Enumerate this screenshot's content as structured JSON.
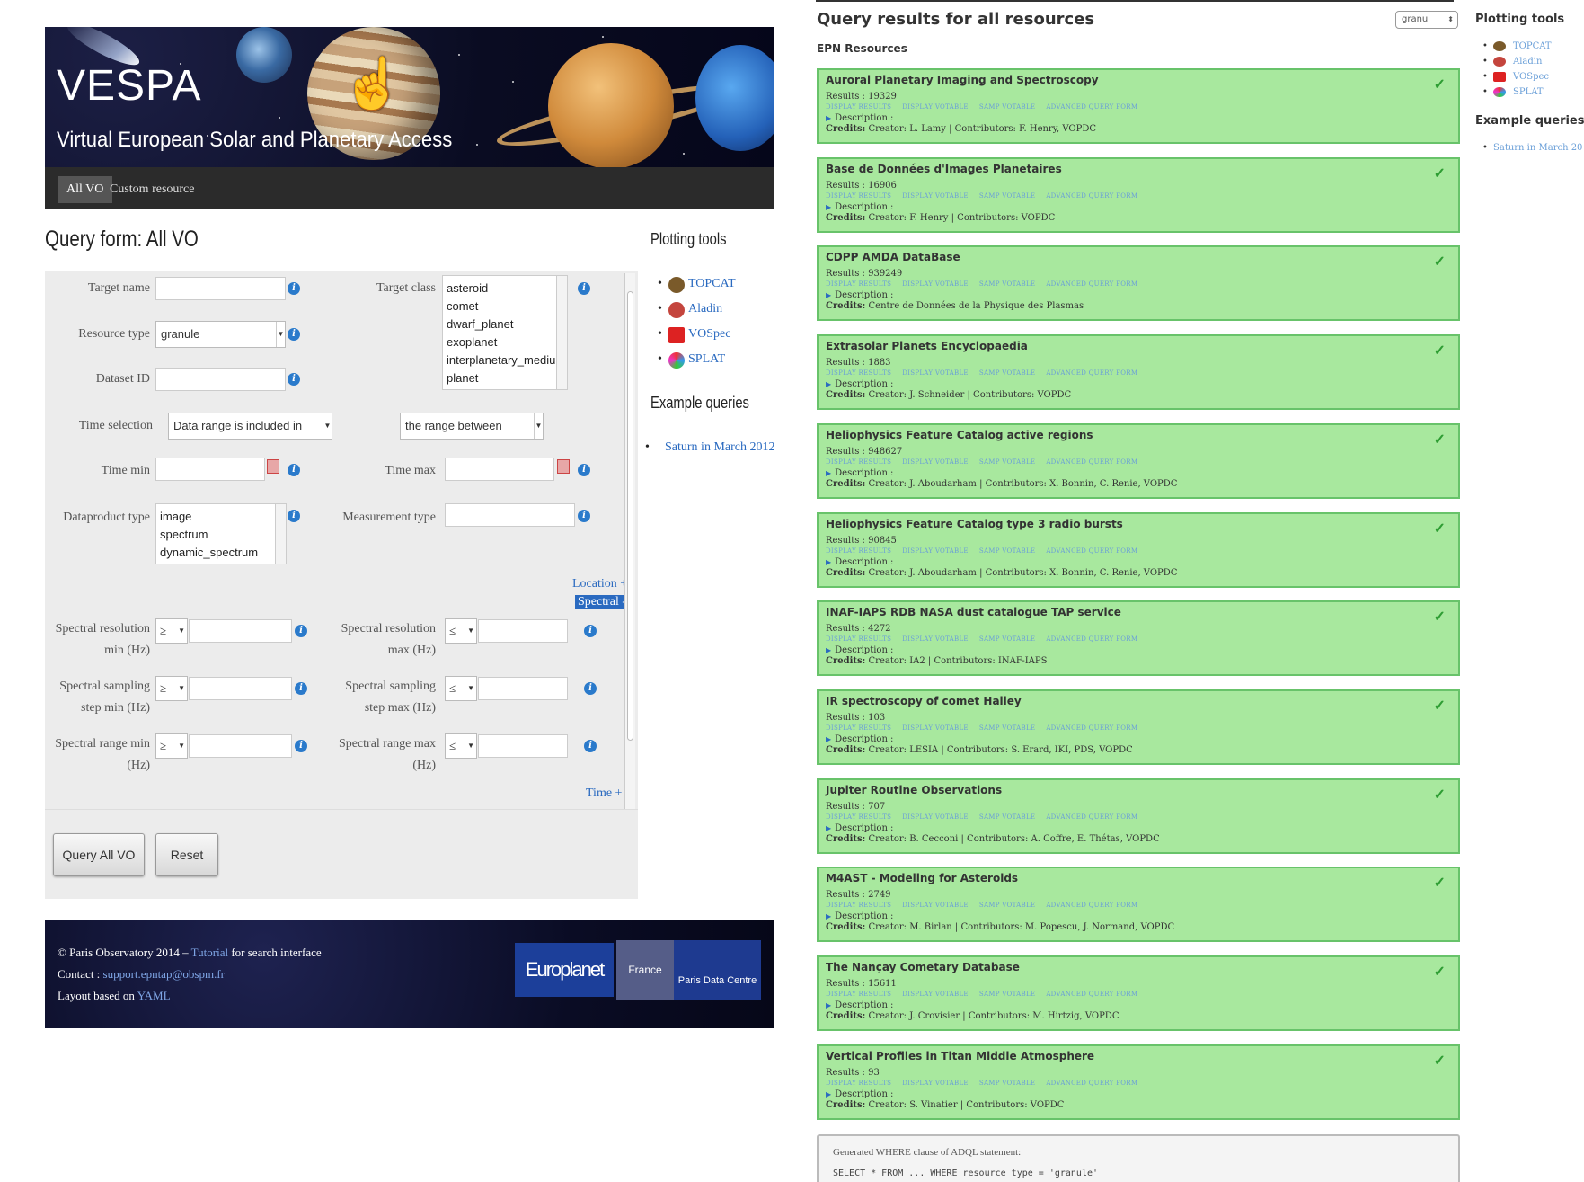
{
  "vespa": {
    "brand_title": "VESPA",
    "brand_subtitle": "Virtual European Solar and Planetary Access",
    "nav": [
      "All VO",
      "Custom resource"
    ],
    "form_title": "Query form: All VO",
    "fields": {
      "target_name": "Target name",
      "target_class": "Target class",
      "resource_type": "Resource type",
      "resource_type_value": "granule",
      "dataset_id": "Dataset ID",
      "time_selection": "Time selection",
      "time_selection_value": "Data range is included in",
      "time_range_value": "the range between",
      "time_min": "Time min",
      "time_max": "Time max",
      "dataproduct_type": "Dataproduct type",
      "measurement_type": "Measurement type",
      "spectral_res_min_1": "Spectral resolution",
      "spectral_res_min_2": "min (Hz)",
      "spectral_res_max_1": "Spectral resolution",
      "spectral_res_max_2": "max (Hz)",
      "spectral_samp_min_1": "Spectral sampling",
      "spectral_samp_min_2": "step min (Hz)",
      "spectral_samp_max_1": "Spectral sampling",
      "spectral_samp_max_2": "step max (Hz)",
      "spectral_range_min_1": "Spectral range min",
      "spectral_range_min_2": "(Hz)",
      "spectral_range_max_1": "Spectral range max",
      "spectral_range_max_2": "(Hz)",
      "op_ge": "≥",
      "op_le": "≤"
    },
    "target_classes": [
      "asteroid",
      "comet",
      "dwarf_planet",
      "exoplanet",
      "interplanetary_medium",
      "planet"
    ],
    "dataproduct_types": [
      "image",
      "spectrum",
      "dynamic_spectrum"
    ],
    "sections": {
      "location": "Location +",
      "spectral": "Spectral -",
      "time": "Time +"
    },
    "buttons": {
      "query": "Query All VO",
      "reset": "Reset"
    },
    "plotting_title": "Plotting tools",
    "plotting_tools": [
      "TOPCAT",
      "Aladin",
      "VOSpec",
      "SPLAT"
    ],
    "example_title": "Example queries",
    "example_queries": [
      "Saturn in March 2012"
    ],
    "footer": {
      "line1_pre": "© Paris Observatory 2014 – ",
      "line1_link": "Tutorial",
      "line1_post": " for search interface",
      "line2_pre": "Contact : ",
      "line2_link": "support.epntap@obspm.fr",
      "line3_pre": "Layout based on ",
      "line3_link": "YAML",
      "logo_europlanet": "Europlanet",
      "logo_france": "France",
      "logo_pdc": "Paris Data Centre"
    }
  },
  "results": {
    "title": "Query results for all resources",
    "subtitle": "EPN Resources",
    "select_value": "granu",
    "link_labels": [
      "DISPLAY RESULTS",
      "DISPLAY VOTABLE",
      "SAMP VOTABLE",
      "ADVANCED QUERY FORM"
    ],
    "desc_label": "Description :",
    "credits_label": "Credits:",
    "cards": [
      {
        "title": "Auroral Planetary Imaging and Spectroscopy",
        "results": "Results : 19329",
        "credits": "Creator: L. Lamy | Contributors: F. Henry, VOPDC"
      },
      {
        "title": "Base de Données d'Images Planetaires",
        "results": "Results : 16906",
        "credits": "Creator: F. Henry | Contributors: VOPDC"
      },
      {
        "title": "CDPP AMDA DataBase",
        "results": "Results : 939249",
        "credits": "Centre de Données de la Physique des Plasmas"
      },
      {
        "title": "Extrasolar Planets Encyclopaedia",
        "results": "Results : 1883",
        "credits": "Creator: J. Schneider | Contributors: VOPDC"
      },
      {
        "title": "Heliophysics Feature Catalog active regions",
        "results": "Results : 948627",
        "credits": "Creator: J. Aboudarham | Contributors: X. Bonnin, C. Renie, VOPDC"
      },
      {
        "title": "Heliophysics Feature Catalog type 3 radio bursts",
        "results": "Results : 90845",
        "credits": "Creator: J. Aboudarham | Contributors: X. Bonnin, C. Renie, VOPDC"
      },
      {
        "title": "INAF-IAPS RDB NASA dust catalogue TAP service",
        "results": "Results : 4272",
        "credits": "Creator: IA2 | Contributors: INAF-IAPS"
      },
      {
        "title": "IR spectroscopy of comet Halley",
        "results": "Results : 103",
        "credits": "Creator: LESIA | Contributors: S. Erard, IKI, PDS, VOPDC"
      },
      {
        "title": "Jupiter Routine Observations",
        "results": "Results : 707",
        "credits": "Creator: B. Cecconi | Contributors: A. Coffre, E. Thétas, VOPDC"
      },
      {
        "title": "M4AST - Modeling for Asteroids",
        "results": "Results : 2749",
        "credits": "Creator: M. Birlan | Contributors: M. Popescu, J. Normand, VOPDC"
      },
      {
        "title": "The Nançay Cometary Database",
        "results": "Results : 15611",
        "credits": "Creator: J. Crovisier | Contributors: M. Hirtzig, VOPDC"
      },
      {
        "title": "Vertical Profiles in Titan Middle Atmosphere",
        "results": "Results : 93",
        "credits": "Creator: S. Vinatier | Contributors: VOPDC"
      }
    ],
    "adql_caption": "Generated WHERE clause of ADQL statement:",
    "adql_code": "SELECT * FROM ... WHERE resource_type = 'granule'",
    "plotting_title": "Plotting tools",
    "plotting_tools": [
      "TOPCAT",
      "Aladin",
      "VOSpec",
      "SPLAT"
    ],
    "example_title": "Example queries",
    "example_queries": [
      "Saturn in March 20"
    ]
  },
  "colors": {
    "card_bg": "#a8e89e",
    "card_border": "#68c36a",
    "link": "#2a6ac0"
  }
}
